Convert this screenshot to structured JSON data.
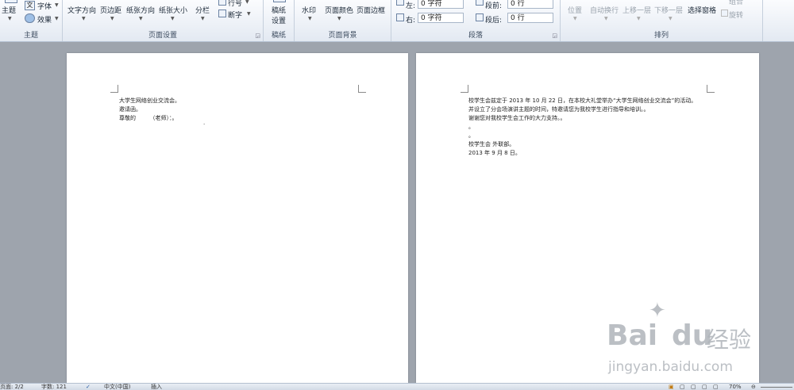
{
  "ribbon": {
    "theme": {
      "themes_label": "主题",
      "fonts_label": "字体",
      "effects_label": "效果",
      "group_label": "主题"
    },
    "page_setup": {
      "text_direction": "文字方向",
      "margins": "页边距",
      "orientation": "纸张方向",
      "size": "纸张大小",
      "columns": "分栏",
      "line_numbers": "行号",
      "hyphenation": "断字",
      "group_label": "页面设置"
    },
    "draft": {
      "draft_setup_line1": "稿纸",
      "draft_setup_line2": "设置",
      "group_label": "稿纸"
    },
    "page_background": {
      "watermark": "水印",
      "page_color": "页面颜色",
      "page_borders": "页面边框",
      "group_label": "页面背景"
    },
    "paragraph": {
      "indent_left_label": "左:",
      "indent_left_value": "0 字符",
      "indent_right_label": "右:",
      "indent_right_value": "0 字符",
      "spacing_before_label": "段前:",
      "spacing_before_value": "0 行",
      "spacing_after_label": "段后:",
      "spacing_after_value": "0 行",
      "group_label": "段落"
    },
    "arrange": {
      "position": "位置",
      "wrap_text": "自动换行",
      "bring_forward": "上移一层",
      "send_backward": "下移一层",
      "selection_pane": "选择窗格",
      "group": "组合",
      "rotate": "旋转",
      "group_label": "排列"
    }
  },
  "document": {
    "page1": {
      "lines": [
        "大学生网络创业交流会。",
        "邀请函。",
        "尊敬的　　　（老师）：。"
      ],
      "trailing_mark": "."
    },
    "page2": {
      "lines": [
        "校学生会兹定于 2013 年 10 月 22 日，在本校大礼堂举办“大学生网络创业交流会”的活动。",
        "并设立了分会场演讲主题的时间，特邀请您为我校学生进行指导和培训。。",
        "谢谢您对我校学生会工作的大力支持。。",
        "。",
        "。",
        "校学生会 外联部。",
        "2013 年 9 月 8 日。"
      ]
    }
  },
  "status_bar": {
    "page": "页面: 2/2",
    "words": "字数: 121",
    "language": "中文(中国)",
    "mode": "插入",
    "zoom": "70%"
  },
  "watermark": {
    "brand_latin": "Bai",
    "brand_latin2": "du",
    "brand_cn": "经验",
    "url": "jingyan.baidu.com"
  }
}
